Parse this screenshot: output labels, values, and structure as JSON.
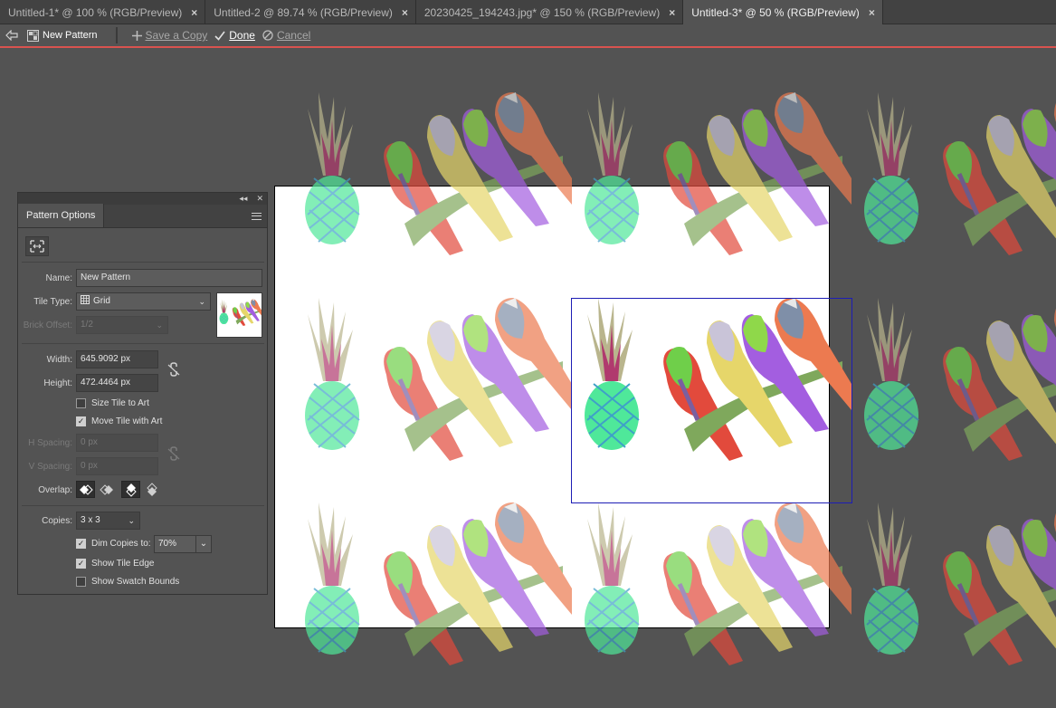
{
  "tabs": [
    {
      "label": "Untitled-1* @ 100 % (RGB/Preview)",
      "active": false
    },
    {
      "label": "Untitled-2 @ 89.74 % (RGB/Preview)",
      "active": false
    },
    {
      "label": "20230425_194243.jpg* @ 150 % (RGB/Preview)",
      "active": false
    },
    {
      "label": "Untitled-3* @ 50 % (RGB/Preview)",
      "active": true
    }
  ],
  "tab_close_glyph": "×",
  "pattern_bar": {
    "name": "New Pattern",
    "save_copy": "Save a Copy",
    "done": "Done",
    "cancel": "Cancel",
    "accent_color": "#d9534f"
  },
  "panel": {
    "collapse_glyph": "◂◂",
    "close_glyph": "✕",
    "title": "Pattern Options",
    "name_label": "Name:",
    "name_value": "New Pattern",
    "tile_type_label": "Tile Type:",
    "tile_type_value": "Grid",
    "brick_offset_label": "Brick Offset:",
    "brick_offset_value": "1/2",
    "width_label": "Width:",
    "width_value": "645.9092 px",
    "height_label": "Height:",
    "height_value": "472.4464 px",
    "size_tile_to_art": {
      "label": "Size Tile to Art",
      "checked": false
    },
    "move_tile_with_art": {
      "label": "Move Tile with Art",
      "checked": true
    },
    "h_spacing_label": "H Spacing:",
    "h_spacing_value": "0 px",
    "v_spacing_label": "V Spacing:",
    "v_spacing_value": "0 px",
    "overlap_label": "Overlap:",
    "copies_label": "Copies:",
    "copies_value": "3 x 3",
    "dim_copies": {
      "label": "Dim Copies to:",
      "checked": true,
      "value": "70%"
    },
    "show_tile_edge": {
      "label": "Show Tile Edge",
      "checked": true
    },
    "show_swatch_bounds": {
      "label": "Show Swatch Bounds",
      "checked": false
    }
  },
  "check_glyph": "✓",
  "dropdown_glyph": "⌄",
  "tile_edge_color": "#1d1db5"
}
